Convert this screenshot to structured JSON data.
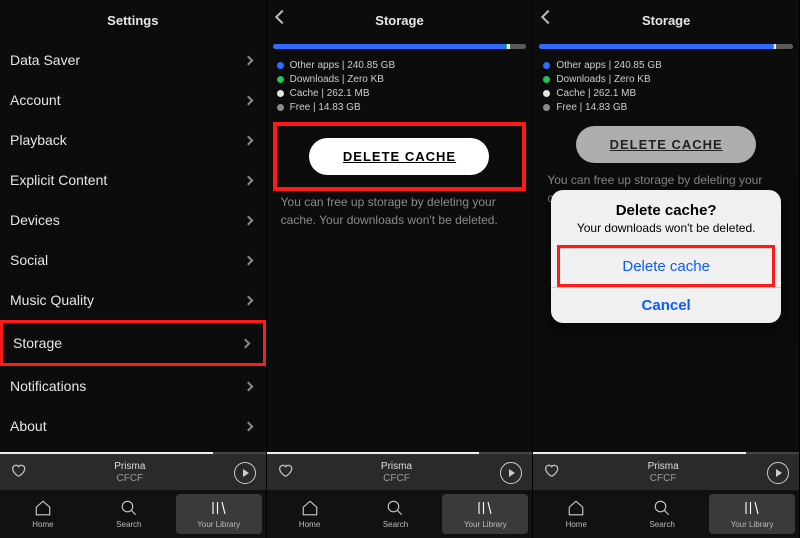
{
  "pane1": {
    "title": "Settings",
    "items": [
      {
        "label": "Data Saver"
      },
      {
        "label": "Account"
      },
      {
        "label": "Playback"
      },
      {
        "label": "Explicit Content"
      },
      {
        "label": "Devices"
      },
      {
        "label": "Social"
      },
      {
        "label": "Music Quality"
      },
      {
        "label": "Storage"
      },
      {
        "label": "Notifications"
      },
      {
        "label": "About"
      }
    ]
  },
  "pane2": {
    "title": "Storage",
    "legend": [
      {
        "label": "Other apps",
        "value": "240.85 GB",
        "color": "blue"
      },
      {
        "label": "Downloads",
        "value": "Zero KB",
        "color": "green"
      },
      {
        "label": "Cache",
        "value": "262.1 MB",
        "color": "white"
      },
      {
        "label": "Free",
        "value": "14.83 GB",
        "color": "grey"
      }
    ],
    "delete_label": "DELETE CACHE",
    "helper": "You can free up storage by deleting your cache. Your downloads won't be deleted."
  },
  "pane3": {
    "title": "Storage",
    "legend": [
      {
        "label": "Other apps",
        "value": "240.85 GB",
        "color": "blue"
      },
      {
        "label": "Downloads",
        "value": "Zero KB",
        "color": "green"
      },
      {
        "label": "Cache",
        "value": "262.1 MB",
        "color": "white"
      },
      {
        "label": "Free",
        "value": "14.83 GB",
        "color": "grey"
      }
    ],
    "delete_label": "DELETE CACHE",
    "helper": "You can free up storage by deleting your cache.",
    "alert": {
      "title": "Delete cache?",
      "message": "Your downloads won't be deleted.",
      "confirm": "Delete cache",
      "cancel": "Cancel"
    }
  },
  "nowplaying": {
    "title": "Prisma",
    "artist": "CFCF"
  },
  "tabs": {
    "home": "Home",
    "search": "Search",
    "library": "Your Library"
  }
}
